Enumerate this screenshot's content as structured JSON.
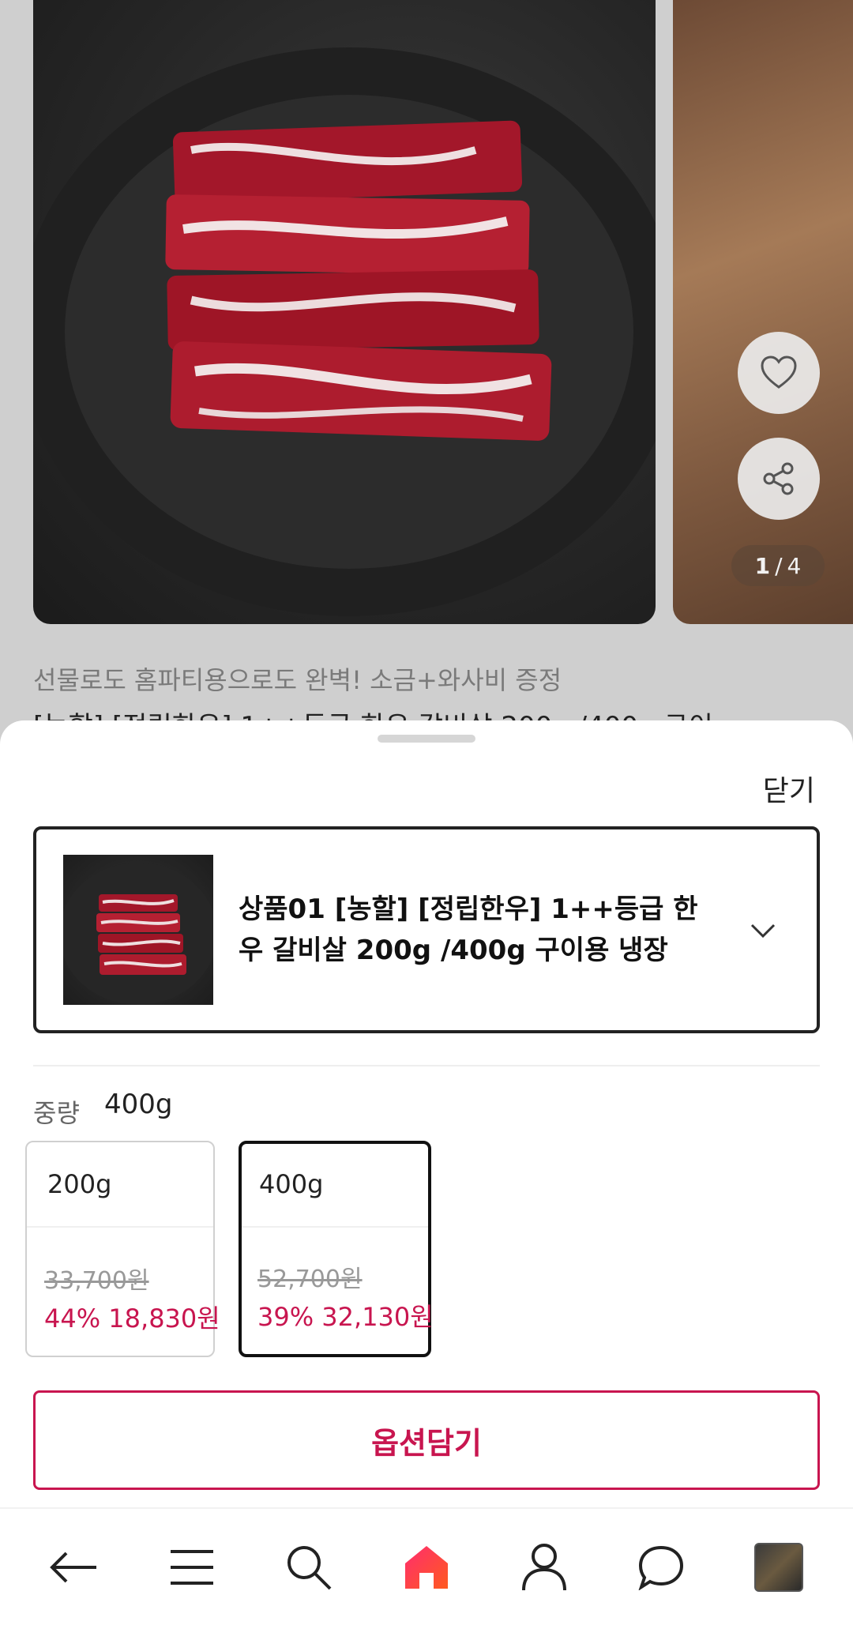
{
  "gallery": {
    "pager_current": "1",
    "pager_separator": "/",
    "pager_total": "4"
  },
  "page": {
    "promo_text": "선물로도 홈파티용으로도 완벽! 소금+와사비 증정",
    "title_text": "[농할] [정립한우] 1++등급 한우 갈비살 200g /400g 구이"
  },
  "sheet": {
    "close_label": "닫기",
    "product_name": "상품01 [농할] [정립한우] 1++등급 한우 갈비살 200g /400g 구이용 냉장",
    "option_label": "중량",
    "option_selected": "400g",
    "options": [
      {
        "size": "200g",
        "original_price": "33,700원",
        "sale": "44% 18,830원"
      },
      {
        "size": "400g",
        "original_price": "52,700원",
        "sale": "39% 32,130원"
      }
    ],
    "add_button_label": "옵션담기"
  },
  "colors": {
    "accent": "#c8154f",
    "home_icon_gradient": [
      "#ff2d6f",
      "#ff5a1f"
    ]
  },
  "nav": {
    "icons": [
      "back-arrow-icon",
      "menu-icon",
      "search-icon",
      "home-icon",
      "user-icon",
      "chat-icon",
      "recent-item-thumbnail"
    ]
  }
}
